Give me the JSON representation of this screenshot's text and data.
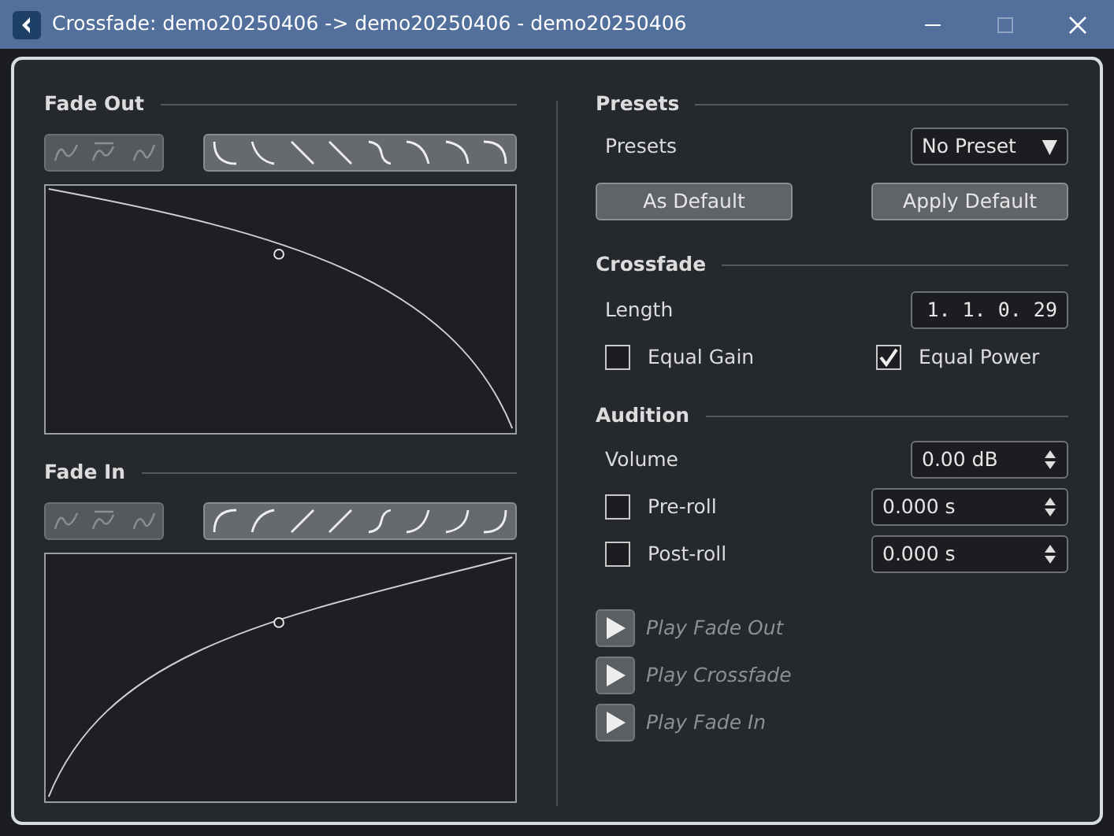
{
  "window": {
    "title": "Crossfade: demo20250406 -> demo20250406 - demo20250406"
  },
  "fades": [
    {
      "kind": "out",
      "title": "Fade Out",
      "spline_tools": {
        "disabled": true
      }
    },
    {
      "kind": "in",
      "title": "Fade In",
      "spline_tools": {
        "disabled": true
      }
    }
  ],
  "presets": {
    "heading": "Presets",
    "label": "Presets",
    "value": "No Preset",
    "arrow": "▼",
    "buttons": [
      "As Default",
      "Apply Default"
    ]
  },
  "crossfade": {
    "heading": "Crossfade",
    "length_label": "Length",
    "length_value": "1. 1. 0. 29",
    "options": [
      {
        "label": "Equal Gain",
        "checked": false
      },
      {
        "label": "Equal Power",
        "checked": true
      }
    ]
  },
  "audition": {
    "heading": "Audition",
    "volume_label": "Volume",
    "volume_value": "0.00 dB",
    "rolls": [
      {
        "label": "Pre-roll",
        "checked": false,
        "value": "0.000 s"
      },
      {
        "label": "Post-roll",
        "checked": false,
        "value": "0.000 s"
      }
    ],
    "play": [
      {
        "label": "Play Fade Out",
        "disabled": true
      },
      {
        "label": "Play Crossfade",
        "disabled": true
      },
      {
        "label": "Play Fade In",
        "disabled": true
      }
    ]
  }
}
